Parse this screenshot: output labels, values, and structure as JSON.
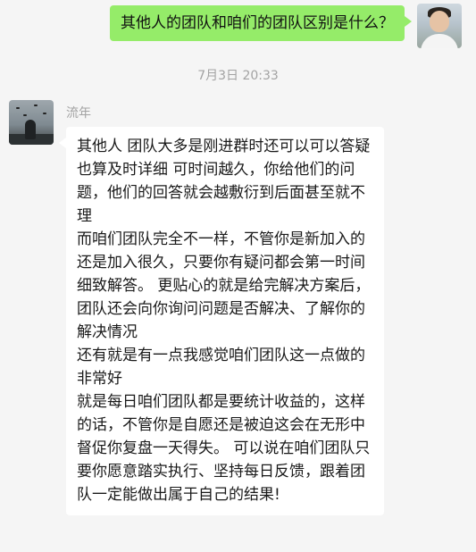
{
  "outgoing_message": {
    "text": "其他人的团队和咱们的团队区别是什么？"
  },
  "timestamp": "7月3日 20:33",
  "incoming_message": {
    "sender": "流年",
    "text": "其他人 团队大多是刚进群时还可以可以答疑也算及时详细 可时间越久，你给他们的问题，他们的回答就会越敷衍到后面甚至就不理\n而咱们团队完全不一样，不管你是新加入的还是加入很久，只要你有疑问都会第一时间细致解答。 更贴心的就是给完解决方案后，团队还会向你询问问题是否解决、了解你的解决情况\n还有就是有一点我感觉咱们团队这一点做的非常好\n就是每日咱们团队都是要统计收益的，这样的话，不管你是自愿还是被迫这会在无形中督促你复盘一天得失。 可以说在咱们团队只要你愿意踏实执行、坚持每日反馈，跟着团队一定能做出属于自己的结果!"
  },
  "colors": {
    "background": "#f5f5f5",
    "outgoing_bubble": "#95ec69",
    "incoming_bubble": "#ffffff",
    "meta_text": "#a3a3a3"
  },
  "icons": {
    "self_avatar": "user-photo-avatar",
    "other_avatar": "seaside-photo-avatar"
  }
}
